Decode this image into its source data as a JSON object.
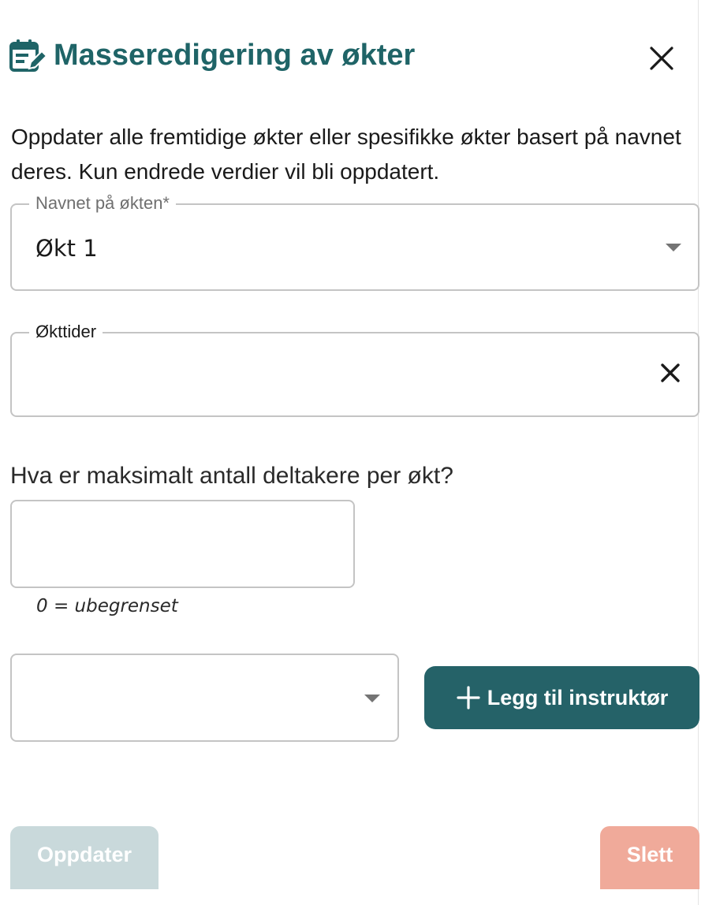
{
  "dialog": {
    "title": "Masseredigering av økter",
    "title_icon": "calendar-edit-icon",
    "close_icon": "close-icon",
    "accent_color": "#1f6467"
  },
  "description": "Oppdater alle fremtidige økter eller spesifikke økter basert på navnet deres. Kun endrede verdier vil bli oppdatert.",
  "session_name": {
    "label": "Navnet på økten*",
    "value": "Økt 1",
    "icon": "caret-down-icon"
  },
  "session_times": {
    "label": "Økttider",
    "value": "",
    "clear_icon": "clear-icon"
  },
  "max_participants": {
    "question": "Hva er maksimalt antall deltakere per økt?",
    "value": "",
    "helper": "0 = ubegrenset"
  },
  "instructor": {
    "selected": "",
    "icon": "caret-down-icon",
    "add_button_label": "Legg til instruktør",
    "add_button_icon": "plus-icon",
    "button_color": "#256268"
  },
  "footer": {
    "update_label": "Oppdater",
    "delete_label": "Slett",
    "update_color": "#c9d9db",
    "delete_color": "#f0aa9a"
  }
}
